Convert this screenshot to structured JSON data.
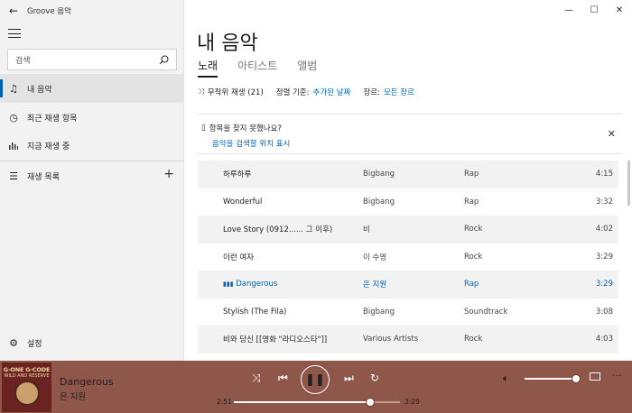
{
  "app": {
    "title": "Groove 음악"
  },
  "sidebar": {
    "search_placeholder": "검색",
    "items": [
      {
        "label": "내 음악",
        "icon": "music-note-icon",
        "active": true
      },
      {
        "label": "최근 재생 항목",
        "icon": "clock-icon"
      },
      {
        "label": "지금 재생 중",
        "icon": "bars-icon"
      },
      {
        "label": "재생 목록",
        "icon": "list-icon"
      }
    ],
    "settings_label": "설정"
  },
  "main": {
    "title": "내 음악",
    "tabs": [
      {
        "label": "노래",
        "active": true
      },
      {
        "label": "아티스트"
      },
      {
        "label": "앨범"
      }
    ],
    "toolbar": {
      "shuffle_label": "무작위 재생 (21)",
      "sort_label": "정렬 기준:",
      "sort_value": "추가된 날짜",
      "genre_label": "장르:",
      "genre_value": "모든 장르"
    },
    "notice": {
      "title": "항목을 찾지 못했나요?",
      "link": "음악을 검색할 위치 표시"
    },
    "songs": [
      {
        "title": "하루하루",
        "artist": "Bigbang",
        "genre": "Rap",
        "duration": "4:15"
      },
      {
        "title": "Wonderful",
        "artist": "Bigbang",
        "genre": "Rap",
        "duration": "3:32"
      },
      {
        "title": "Love Story (0912...... 그 이후)",
        "artist": "비",
        "genre": "Rock",
        "duration": "4:02"
      },
      {
        "title": "이런 여자",
        "artist": "이 수영",
        "genre": "Rock",
        "duration": "3:29"
      },
      {
        "title": "Dangerous",
        "artist": "은 지원",
        "genre": "Rap",
        "duration": "3:29",
        "playing": true
      },
      {
        "title": "Stylish (The Fila)",
        "artist": "Bigbang",
        "genre": "Soundtrack",
        "duration": "3:08"
      },
      {
        "title": "비와 당신 [[영화 \"라디오스타\"]]",
        "artist": "Various Artists",
        "genre": "Rock",
        "duration": "4:03"
      }
    ]
  },
  "player": {
    "album_art_text": "G-ONE G-CODE",
    "album_art_subtext": "WILD AND RESERVE",
    "title": "Dangerous",
    "artist": "은 지원",
    "elapsed": "2:51",
    "total": "3:29",
    "progress": 0.82,
    "volume": 1.0
  },
  "colors": {
    "accent": "#0063b1",
    "player_bg": "#8e574a"
  }
}
